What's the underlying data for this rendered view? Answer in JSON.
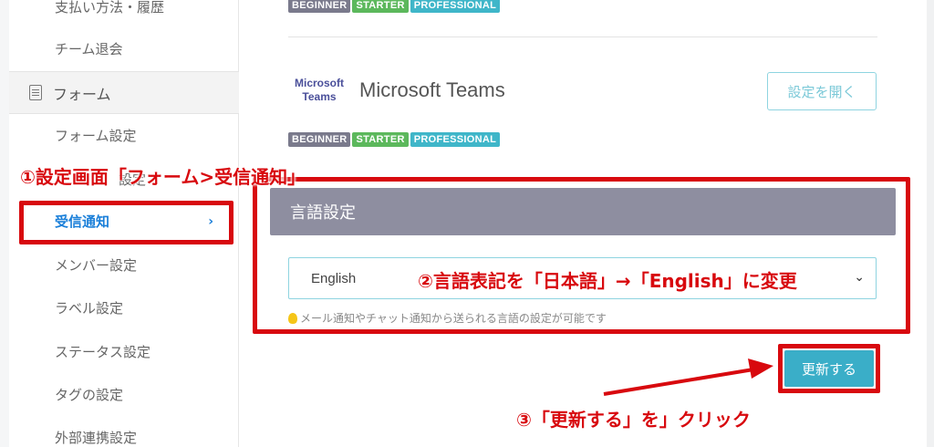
{
  "sidebar": {
    "items": [
      {
        "label": "支払い方法・履歴"
      },
      {
        "label": "チーム退会"
      },
      {
        "label": "フォーム"
      },
      {
        "label": "フォーム設定"
      },
      {
        "label": "設定"
      },
      {
        "label": "受信通知"
      },
      {
        "label": "メンバー設定"
      },
      {
        "label": "ラベル設定"
      },
      {
        "label": "ステータス設定"
      },
      {
        "label": "タグの設定"
      },
      {
        "label": "外部連携設定"
      }
    ],
    "active_chevron": "›"
  },
  "plans": {
    "beginner": "BEGINNER",
    "starter": "STARTER",
    "professional": "PROFESSIONAL"
  },
  "integration": {
    "logo_line1": "Microsoft",
    "logo_line2": "Teams",
    "title": "Microsoft Teams",
    "open_button": "設定を開く"
  },
  "language": {
    "header": "言語設定",
    "selected": "English",
    "hint": "メール通知やチャット通知から送られる言語の設定が可能です"
  },
  "update_button": "更新する",
  "annotations": {
    "step1": "①設定画面「フォーム>受信通知」",
    "step2": "②言語表記を「日本語」→「English」に変更",
    "step3": "③「更新する」を」クリック"
  },
  "colors": {
    "annotation": "#d8090e",
    "accent": "#3aaec8",
    "active_link": "#1a7fd9",
    "header_bg": "#8e8ea0"
  }
}
